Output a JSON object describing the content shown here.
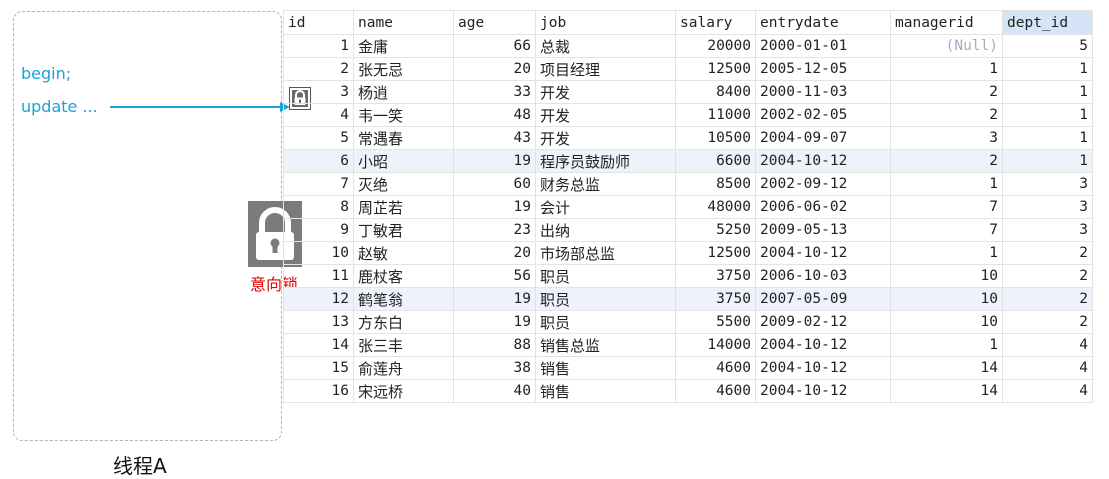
{
  "thread": {
    "code": [
      "begin;",
      "update ..."
    ],
    "label": "线程A"
  },
  "intent_lock": {
    "label": "意向锁",
    "icon": "lock-icon"
  },
  "row_lock": {
    "icon": "lock-icon",
    "row_index": 2
  },
  "colors": {
    "code": "#1aa2d8",
    "lock_label": "#e00000",
    "selected_header": "#d5e5f7",
    "row_highlight": "#eef3fb"
  },
  "table": {
    "columns": [
      "id",
      "name",
      "age",
      "job",
      "salary",
      "entrydate",
      "managerid",
      "dept_id"
    ],
    "selected_column": 7,
    "highlighted_rows": [
      5,
      11
    ],
    "rows": [
      [
        "1",
        "金庸",
        "66",
        "总裁",
        "20000",
        "2000-01-01",
        "(Null)",
        "5"
      ],
      [
        "2",
        "张无忌",
        "20",
        "项目经理",
        "12500",
        "2005-12-05",
        "1",
        "1"
      ],
      [
        "3",
        "杨逍",
        "33",
        "开发",
        "8400",
        "2000-11-03",
        "2",
        "1"
      ],
      [
        "4",
        "韦一笑",
        "48",
        "开发",
        "11000",
        "2002-02-05",
        "2",
        "1"
      ],
      [
        "5",
        "常遇春",
        "43",
        "开发",
        "10500",
        "2004-09-07",
        "3",
        "1"
      ],
      [
        "6",
        "小昭",
        "19",
        "程序员鼓励师",
        "6600",
        "2004-10-12",
        "2",
        "1"
      ],
      [
        "7",
        "灭绝",
        "60",
        "财务总监",
        "8500",
        "2002-09-12",
        "1",
        "3"
      ],
      [
        "8",
        "周芷若",
        "19",
        "会计",
        "48000",
        "2006-06-02",
        "7",
        "3"
      ],
      [
        "9",
        "丁敏君",
        "23",
        "出纳",
        "5250",
        "2009-05-13",
        "7",
        "3"
      ],
      [
        "10",
        "赵敏",
        "20",
        "市场部总监",
        "12500",
        "2004-10-12",
        "1",
        "2"
      ],
      [
        "11",
        "鹿杖客",
        "56",
        "职员",
        "3750",
        "2006-10-03",
        "10",
        "2"
      ],
      [
        "12",
        "鹤笔翁",
        "19",
        "职员",
        "3750",
        "2007-05-09",
        "10",
        "2"
      ],
      [
        "13",
        "方东白",
        "19",
        "职员",
        "5500",
        "2009-02-12",
        "10",
        "2"
      ],
      [
        "14",
        "张三丰",
        "88",
        "销售总监",
        "14000",
        "2004-10-12",
        "1",
        "4"
      ],
      [
        "15",
        "俞莲舟",
        "38",
        "销售",
        "4600",
        "2004-10-12",
        "14",
        "4"
      ],
      [
        "16",
        "宋远桥",
        "40",
        "销售",
        "4600",
        "2004-10-12",
        "14",
        "4"
      ]
    ]
  }
}
